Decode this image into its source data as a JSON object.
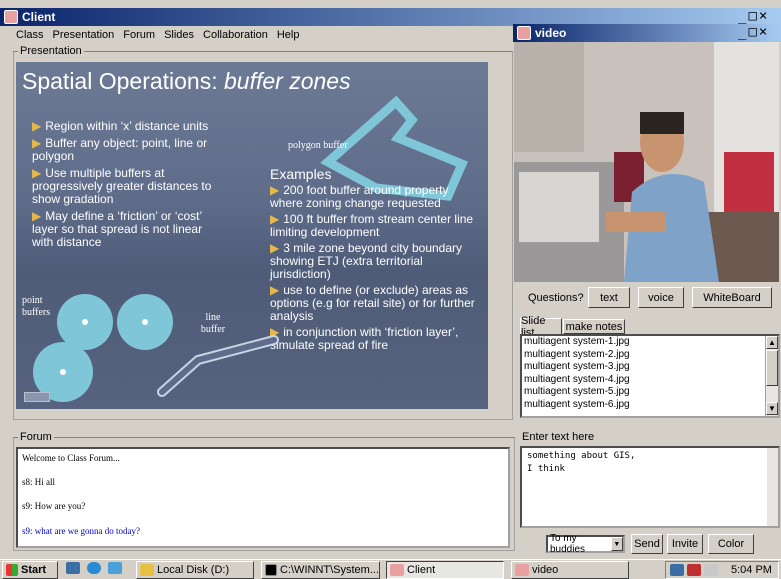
{
  "main_window": {
    "title": "Client"
  },
  "menu": [
    "Class",
    "Presentation",
    "Forum",
    "Slides",
    "Collaboration",
    "Help"
  ],
  "presentation": {
    "label": "Presentation",
    "slide": {
      "title_prefix": "Spatial Operations: ",
      "title_em": "buffer zones",
      "bullets_left": [
        "Region within ‘x’ distance units",
        "Buffer any object: point, line or polygon",
        "Use multiple buffers at progressively greater distances to show gradation",
        "May  define a ‘friction’ or ‘cost’ layer so that spread is not linear with distance"
      ],
      "polygon_label": "polygon buffer",
      "point_label": "point buffers",
      "line_label": "line buffer",
      "examples_heading": "Examples",
      "examples": [
        "200 foot buffer around property where zoning change requested",
        "100 ft buffer from stream center line limiting development",
        "3 mile zone beyond city boundary showing ETJ (extra territorial jurisdiction)",
        "use to define (or exclude) areas as options  (e.g for retail site) or for further analysis",
        "in conjunction with ‘friction layer’, simulate spread of fire"
      ]
    }
  },
  "video_window": {
    "title": "video"
  },
  "questions": {
    "label": "Questions?",
    "text_btn": "text",
    "voice_btn": "voice",
    "whiteboard_btn": "WhiteBoard"
  },
  "tabs": {
    "slide_list": "Slide list",
    "make_notes": "make notes"
  },
  "slides": [
    "multiagent system-1.jpg",
    "multiagent system-2.jpg",
    "multiagent system-3.jpg",
    "multiagent system-4.jpg",
    "multiagent system-5.jpg",
    "multiagent system-6.jpg"
  ],
  "forum": {
    "label": "Forum",
    "messages": [
      "Welcome to Class Forum...",
      "s8:  Hi all",
      "s9:   How are you?",
      "s9:   what are we gonna do today?"
    ],
    "highlight_color": "#0000cc"
  },
  "chat": {
    "label": "Enter text here",
    "input_line1": "something about GIS,",
    "input_line2": "I think",
    "recipient": "To my buddies",
    "send_btn": "Send",
    "invite_btn": "Invite",
    "color_btn": "Color"
  },
  "taskbar": {
    "start": "Start",
    "tasks": [
      "Local Disk (D:)",
      "C:\\WINNT\\System...",
      "Client",
      "video"
    ],
    "clock": "5:04 PM"
  }
}
